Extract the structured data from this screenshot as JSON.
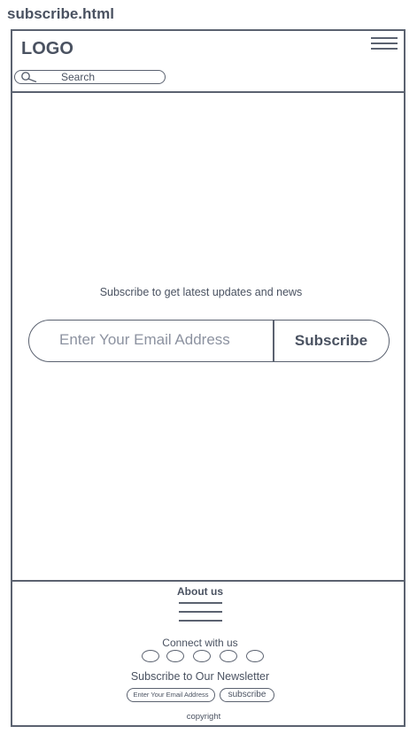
{
  "file": {
    "title": "subscribe.html"
  },
  "header": {
    "logo": "LOGO",
    "menu_icon": "hamburger-menu-icon",
    "search": {
      "label": "Search",
      "icon": "search-icon"
    }
  },
  "main": {
    "tagline": "Subscribe to get latest updates and news",
    "email_placeholder": "Enter Your Email Address",
    "subscribe_label": "Subscribe"
  },
  "footer": {
    "about": "About us",
    "connect": "Connect with us",
    "social_icons": [
      "social-icon-1",
      "social-icon-2",
      "social-icon-3",
      "social-icon-4",
      "social-icon-5"
    ],
    "newsletter_title": "Subscribe to Our Newsletter",
    "newsletter_placeholder": "Enter Your Email Address",
    "newsletter_button": "subscribe",
    "copyright": "copyright"
  },
  "colors": {
    "stroke": "#5b6270",
    "text": "#4a5261",
    "placeholder": "#8c92a0",
    "background": "#ffffff"
  }
}
